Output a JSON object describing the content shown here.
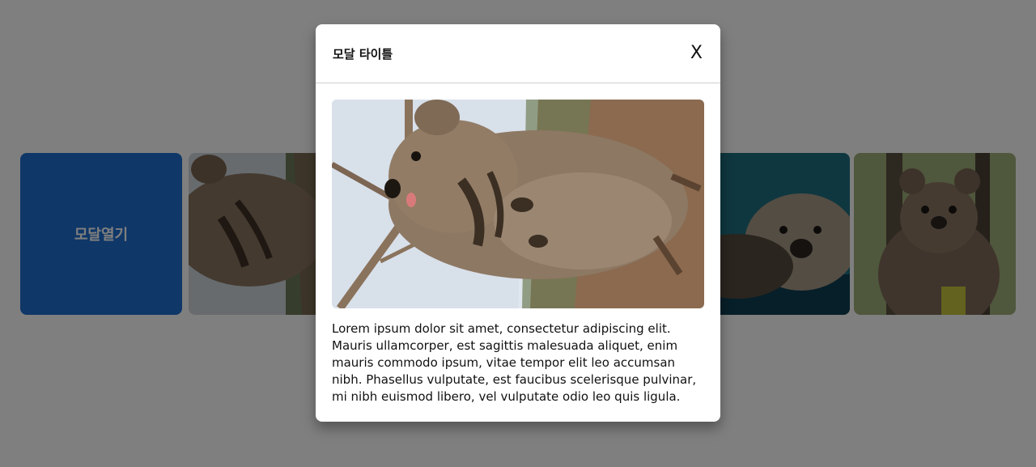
{
  "gallery": {
    "open_button_label": "모달열기",
    "accent_color": "#1f6fd0",
    "thumbnails": [
      {
        "subject": "quokka-rotated"
      },
      {
        "subject": "sea-otter"
      },
      {
        "subject": "quokka"
      }
    ]
  },
  "overlay": {
    "color": "#000000",
    "opacity": 0.5
  },
  "modal": {
    "title": "모달 타이틀",
    "close_label": "X",
    "image_subject": "quokka-rotated",
    "body_text": "Lorem ipsum dolor sit amet, consectetur adipiscing elit. Mauris ullamcorper, est sagittis malesuada aliquet, enim mauris commodo ipsum, vitae tempor elit leo accumsan nibh. Phasellus vulputate, est faucibus scelerisque pulvinar, mi nibh euismod libero, vel vulputate odio leo quis ligula."
  }
}
